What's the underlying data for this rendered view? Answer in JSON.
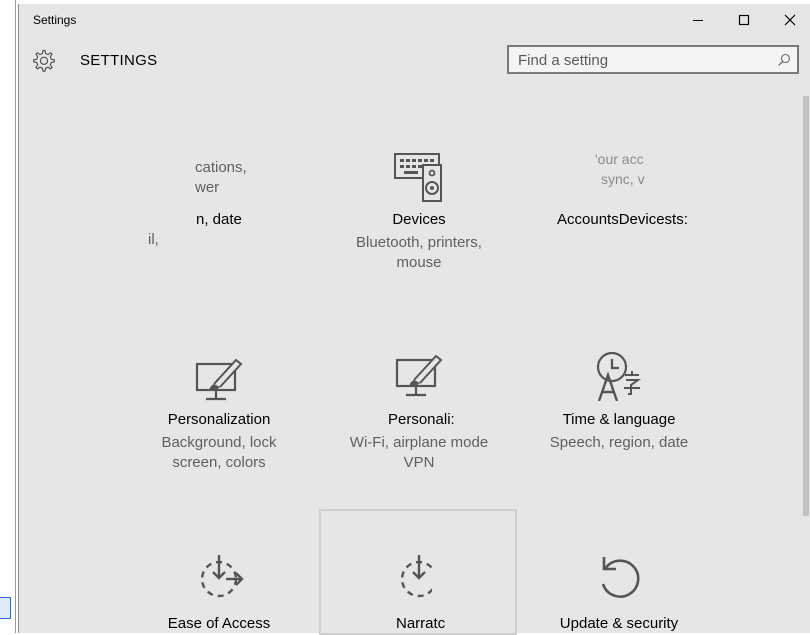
{
  "window": {
    "title": "Settings"
  },
  "header": {
    "title": "SETTINGS"
  },
  "search": {
    "placeholder": "Find a setting"
  },
  "tiles": {
    "system_partial": {
      "line1": "cations,",
      "line2": "wer",
      "name": "n, date",
      "desc": "il,"
    },
    "devices": {
      "name": "Devices",
      "desc1": "Bluetooth, printers,",
      "desc2": "mouse"
    },
    "accounts_partial": {
      "line1": "'our acc",
      "line2": "sync, v",
      "name": "AccountsDevicests:"
    },
    "personalization": {
      "name": "Personalization",
      "desc1": "Background, lock",
      "desc2": "screen, colors"
    },
    "network_partial": {
      "name": "Personali:",
      "desc1": "Wi-Fi, airplane mode",
      "desc2": "VPN"
    },
    "time_language": {
      "name": "Time & language",
      "desc1": "Speech, region, date"
    },
    "ease_of_access": {
      "name": "Ease of Access"
    },
    "narrator": {
      "name": "Narratc"
    },
    "update_security": {
      "name": "Update & security"
    }
  },
  "icons": {
    "gear": "gear-icon",
    "search": "search-icon",
    "devices": "keyboard-speaker-icon",
    "personalization": "monitor-brush-icon",
    "time_language": "clock-language-icon",
    "ease_of_access": "ease-of-access-icon",
    "update": "refresh-icon"
  },
  "colors": {
    "background": "#e6e6e6",
    "icon": "#555555",
    "secondary_text": "#5f5f5f"
  }
}
